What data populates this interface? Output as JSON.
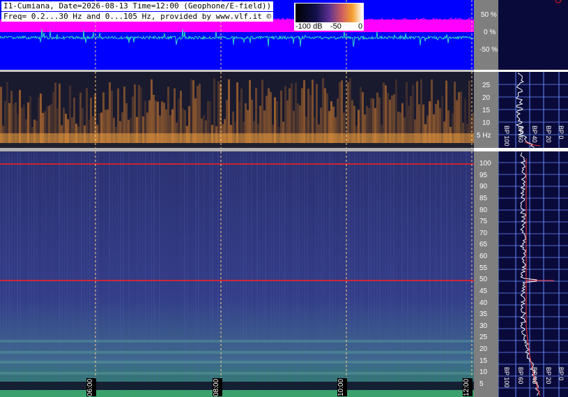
{
  "header": {
    "line1": "I1-Cumiana, Date=2026-08-13 Time=12:00 (Geophone/E-field))",
    "line2": "Freq= 0.2...30 Hz and 0...105 Hz, provided by www.vlf.it ©"
  },
  "colorbar": {
    "labels": [
      "-100 dB",
      "-50",
      "0"
    ]
  },
  "chart_data": [
    {
      "type": "line",
      "panel": "amplitude",
      "yticks": [
        "50 %",
        "0 %",
        "-50 %"
      ]
    },
    {
      "type": "heatmap",
      "panel": "spectrogram-0.2-30Hz",
      "yticks": [
        "25",
        "20",
        "15",
        "10",
        "5 Hz"
      ],
      "ylim": [
        0.2,
        30
      ]
    },
    {
      "type": "heatmap",
      "panel": "spectrogram-0-105Hz",
      "yticks": [
        "100",
        "95",
        "90",
        "85",
        "80",
        "75",
        "70",
        "65",
        "60",
        "55",
        "50",
        "45",
        "40",
        "35",
        "30",
        "25",
        "20",
        "15",
        "10",
        "5"
      ],
      "ylim": [
        0,
        105
      ],
      "x_time_labels": [
        "06:00",
        "08:00",
        "10:00",
        "12:00"
      ]
    },
    {
      "type": "line",
      "panel": "side-spectrum",
      "xticks": [
        "BP 100",
        "BP 60",
        "BP 40",
        "BP 20",
        "BP 0"
      ]
    }
  ],
  "colors": {
    "blue": "#0000ff",
    "magenta": "#ff00ff",
    "red": "#ff2020",
    "grid": "#6a8cff"
  }
}
